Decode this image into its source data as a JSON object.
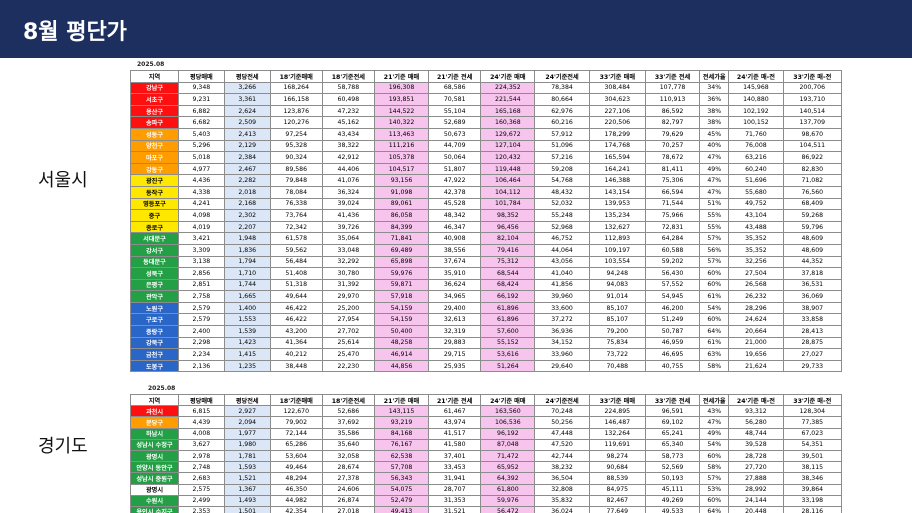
{
  "page_title": "8월 평단가",
  "seoul": {
    "label": "서울시",
    "date": "2025.08",
    "headers": [
      "지역",
      "평당매매",
      "평당전세",
      "18'기준매매",
      "18'기준전세",
      "21'기준 매매",
      "21'기준 전세",
      "24'기준 매매",
      "24'기준전세",
      "33'기준 매매",
      "33'기준 전세",
      "전세가율",
      "24'기준 매-전",
      "33'기준 매-전"
    ],
    "rows": [
      {
        "name": "강남구",
        "color": "red",
        "v": [
          "9,348",
          "3,266",
          "168,264",
          "58,788",
          "196,308",
          "68,586",
          "224,352",
          "78,384",
          "308,484",
          "107,778",
          "34%",
          "145,968",
          "200,706"
        ]
      },
      {
        "name": "서초구",
        "color": "red",
        "v": [
          "9,231",
          "3,361",
          "166,158",
          "60,498",
          "193,851",
          "70,581",
          "221,544",
          "80,664",
          "304,623",
          "110,913",
          "36%",
          "140,880",
          "193,710"
        ]
      },
      {
        "name": "용산구",
        "color": "red",
        "v": [
          "6,882",
          "2,624",
          "123,876",
          "47,232",
          "144,522",
          "55,104",
          "165,168",
          "62,976",
          "227,106",
          "86,592",
          "38%",
          "102,192",
          "140,514"
        ]
      },
      {
        "name": "송파구",
        "color": "red",
        "v": [
          "6,682",
          "2,509",
          "120,276",
          "45,162",
          "140,322",
          "52,689",
          "160,368",
          "60,216",
          "220,506",
          "82,797",
          "38%",
          "100,152",
          "137,709"
        ]
      },
      {
        "name": "성동구",
        "color": "orange",
        "v": [
          "5,403",
          "2,413",
          "97,254",
          "43,434",
          "113,463",
          "50,673",
          "129,672",
          "57,912",
          "178,299",
          "79,629",
          "45%",
          "71,760",
          "98,670"
        ]
      },
      {
        "name": "양천구",
        "color": "orange",
        "v": [
          "5,296",
          "2,129",
          "95,328",
          "38,322",
          "111,216",
          "44,709",
          "127,104",
          "51,096",
          "174,768",
          "70,257",
          "40%",
          "76,008",
          "104,511"
        ]
      },
      {
        "name": "마포구",
        "color": "orange",
        "v": [
          "5,018",
          "2,384",
          "90,324",
          "42,912",
          "105,378",
          "50,064",
          "120,432",
          "57,216",
          "165,594",
          "78,672",
          "47%",
          "63,216",
          "86,922"
        ]
      },
      {
        "name": "강동구",
        "color": "orange",
        "v": [
          "4,977",
          "2,467",
          "89,586",
          "44,406",
          "104,517",
          "51,807",
          "119,448",
          "59,208",
          "164,241",
          "81,411",
          "49%",
          "60,240",
          "82,830"
        ]
      },
      {
        "name": "광진구",
        "color": "yellow",
        "v": [
          "4,436",
          "2,282",
          "79,848",
          "41,076",
          "93,156",
          "47,922",
          "106,464",
          "54,768",
          "146,388",
          "75,306",
          "47%",
          "51,696",
          "71,082"
        ]
      },
      {
        "name": "동작구",
        "color": "yellow",
        "v": [
          "4,338",
          "2,018",
          "78,084",
          "36,324",
          "91,098",
          "42,378",
          "104,112",
          "48,432",
          "143,154",
          "66,594",
          "47%",
          "55,680",
          "76,560"
        ]
      },
      {
        "name": "영등포구",
        "color": "yellow",
        "v": [
          "4,241",
          "2,168",
          "76,338",
          "39,024",
          "89,061",
          "45,528",
          "101,784",
          "52,032",
          "139,953",
          "71,544",
          "51%",
          "49,752",
          "68,409"
        ]
      },
      {
        "name": "중구",
        "color": "yellow",
        "v": [
          "4,098",
          "2,302",
          "73,764",
          "41,436",
          "86,058",
          "48,342",
          "98,352",
          "55,248",
          "135,234",
          "75,966",
          "55%",
          "43,104",
          "59,268"
        ]
      },
      {
        "name": "종로구",
        "color": "yellow",
        "v": [
          "4,019",
          "2,207",
          "72,342",
          "39,726",
          "84,399",
          "46,347",
          "96,456",
          "52,968",
          "132,627",
          "72,831",
          "55%",
          "43,488",
          "59,796"
        ]
      },
      {
        "name": "서대문구",
        "color": "green",
        "v": [
          "3,421",
          "1,948",
          "61,578",
          "35,064",
          "71,841",
          "40,908",
          "82,104",
          "46,752",
          "112,893",
          "64,284",
          "57%",
          "35,352",
          "48,609"
        ]
      },
      {
        "name": "강서구",
        "color": "green",
        "v": [
          "3,309",
          "1,836",
          "59,562",
          "33,048",
          "69,489",
          "38,556",
          "79,416",
          "44,064",
          "109,197",
          "60,588",
          "56%",
          "35,352",
          "48,609"
        ]
      },
      {
        "name": "동대문구",
        "color": "green",
        "v": [
          "3,138",
          "1,794",
          "56,484",
          "32,292",
          "65,898",
          "37,674",
          "75,312",
          "43,056",
          "103,554",
          "59,202",
          "57%",
          "32,256",
          "44,352"
        ]
      },
      {
        "name": "성북구",
        "color": "green",
        "v": [
          "2,856",
          "1,710",
          "51,408",
          "30,780",
          "59,976",
          "35,910",
          "68,544",
          "41,040",
          "94,248",
          "56,430",
          "60%",
          "27,504",
          "37,818"
        ]
      },
      {
        "name": "은평구",
        "color": "green",
        "v": [
          "2,851",
          "1,744",
          "51,318",
          "31,392",
          "59,871",
          "36,624",
          "68,424",
          "41,856",
          "94,083",
          "57,552",
          "60%",
          "26,568",
          "36,531"
        ]
      },
      {
        "name": "관악구",
        "color": "green",
        "v": [
          "2,758",
          "1,665",
          "49,644",
          "29,970",
          "57,918",
          "34,965",
          "66,192",
          "39,960",
          "91,014",
          "54,945",
          "61%",
          "26,232",
          "36,069"
        ]
      },
      {
        "name": "노원구",
        "color": "blue",
        "v": [
          "2,579",
          "1,400",
          "46,422",
          "25,200",
          "54,159",
          "29,400",
          "61,896",
          "33,600",
          "85,107",
          "46,200",
          "54%",
          "28,296",
          "38,907"
        ]
      },
      {
        "name": "구로구",
        "color": "blue",
        "v": [
          "2,579",
          "1,553",
          "46,422",
          "27,954",
          "54,159",
          "32,613",
          "61,896",
          "37,272",
          "85,107",
          "51,249",
          "60%",
          "24,624",
          "33,858"
        ]
      },
      {
        "name": "중랑구",
        "color": "blue",
        "v": [
          "2,400",
          "1,539",
          "43,200",
          "27,702",
          "50,400",
          "32,319",
          "57,600",
          "36,936",
          "79,200",
          "50,787",
          "64%",
          "20,664",
          "28,413"
        ]
      },
      {
        "name": "강북구",
        "color": "blue",
        "v": [
          "2,298",
          "1,423",
          "41,364",
          "25,614",
          "48,258",
          "29,883",
          "55,152",
          "34,152",
          "75,834",
          "46,959",
          "61%",
          "21,000",
          "28,875"
        ]
      },
      {
        "name": "금천구",
        "color": "blue",
        "v": [
          "2,234",
          "1,415",
          "40,212",
          "25,470",
          "46,914",
          "29,715",
          "53,616",
          "33,960",
          "73,722",
          "46,695",
          "63%",
          "19,656",
          "27,027"
        ]
      },
      {
        "name": "도봉구",
        "color": "blue",
        "v": [
          "2,136",
          "1,235",
          "38,448",
          "22,230",
          "44,856",
          "25,935",
          "51,264",
          "29,640",
          "70,488",
          "40,755",
          "58%",
          "21,624",
          "29,733"
        ]
      }
    ]
  },
  "gyeonggi": {
    "label": "경기도",
    "date": "2025.08",
    "headers": [
      "지역",
      "평당매매",
      "평당전세",
      "18'기준매매",
      "18'기준전세",
      "21'기준 매매",
      "21'기준 전세",
      "24'기준 매매",
      "24'기준전세",
      "33'기준 매매",
      "33'기준 전세",
      "전세가율",
      "24'기준 매-전",
      "33'기준 매-전"
    ],
    "rows": [
      {
        "name": "과천시",
        "color": "red",
        "v": [
          "6,815",
          "2,927",
          "122,670",
          "52,686",
          "143,115",
          "61,467",
          "163,560",
          "70,248",
          "224,895",
          "96,591",
          "43%",
          "93,312",
          "128,304"
        ]
      },
      {
        "name": "분당구",
        "color": "orange",
        "v": [
          "4,439",
          "2,094",
          "79,902",
          "37,692",
          "93,219",
          "43,974",
          "106,536",
          "50,256",
          "146,487",
          "69,102",
          "47%",
          "56,280",
          "77,385"
        ]
      },
      {
        "name": "하남시",
        "color": "green",
        "v": [
          "4,008",
          "1,977",
          "72,144",
          "35,586",
          "84,168",
          "41,517",
          "96,192",
          "47,448",
          "132,264",
          "65,241",
          "49%",
          "48,744",
          "67,023"
        ]
      },
      {
        "name": "성남시 수정구",
        "color": "green",
        "v": [
          "3,627",
          "1,980",
          "65,286",
          "35,640",
          "76,167",
          "41,580",
          "87,048",
          "47,520",
          "119,691",
          "65,340",
          "54%",
          "39,528",
          "54,351"
        ]
      },
      {
        "name": "광명시",
        "color": "green",
        "v": [
          "2,978",
          "1,781",
          "53,604",
          "32,058",
          "62,538",
          "37,401",
          "71,472",
          "42,744",
          "98,274",
          "58,773",
          "60%",
          "28,728",
          "39,501"
        ]
      },
      {
        "name": "안양시 동안구",
        "color": "green",
        "v": [
          "2,748",
          "1,593",
          "49,464",
          "28,674",
          "57,708",
          "33,453",
          "65,952",
          "38,232",
          "90,684",
          "52,569",
          "58%",
          "27,720",
          "38,115"
        ]
      },
      {
        "name": "성남시 중원구",
        "color": "green",
        "v": [
          "2,683",
          "1,521",
          "48,294",
          "27,378",
          "56,343",
          "31,941",
          "64,392",
          "36,504",
          "88,539",
          "50,193",
          "57%",
          "27,888",
          "38,346"
        ]
      },
      {
        "name": "광명시",
        "color": "white",
        "v": [
          "2,575",
          "1,367",
          "46,350",
          "24,606",
          "54,075",
          "28,707",
          "61,800",
          "32,808",
          "84,975",
          "45,111",
          "53%",
          "28,992",
          "39,864"
        ]
      },
      {
        "name": "수원시",
        "color": "green",
        "v": [
          "2,499",
          "1,493",
          "44,982",
          "26,874",
          "52,479",
          "31,353",
          "59,976",
          "35,832",
          "82,467",
          "49,269",
          "60%",
          "24,144",
          "33,198"
        ]
      },
      {
        "name": "용인시 수지구",
        "color": "green",
        "v": [
          "2,353",
          "1,501",
          "42,354",
          "27,018",
          "49,413",
          "31,521",
          "56,472",
          "36,024",
          "77,649",
          "49,533",
          "64%",
          "20,448",
          "28,116"
        ]
      }
    ]
  }
}
